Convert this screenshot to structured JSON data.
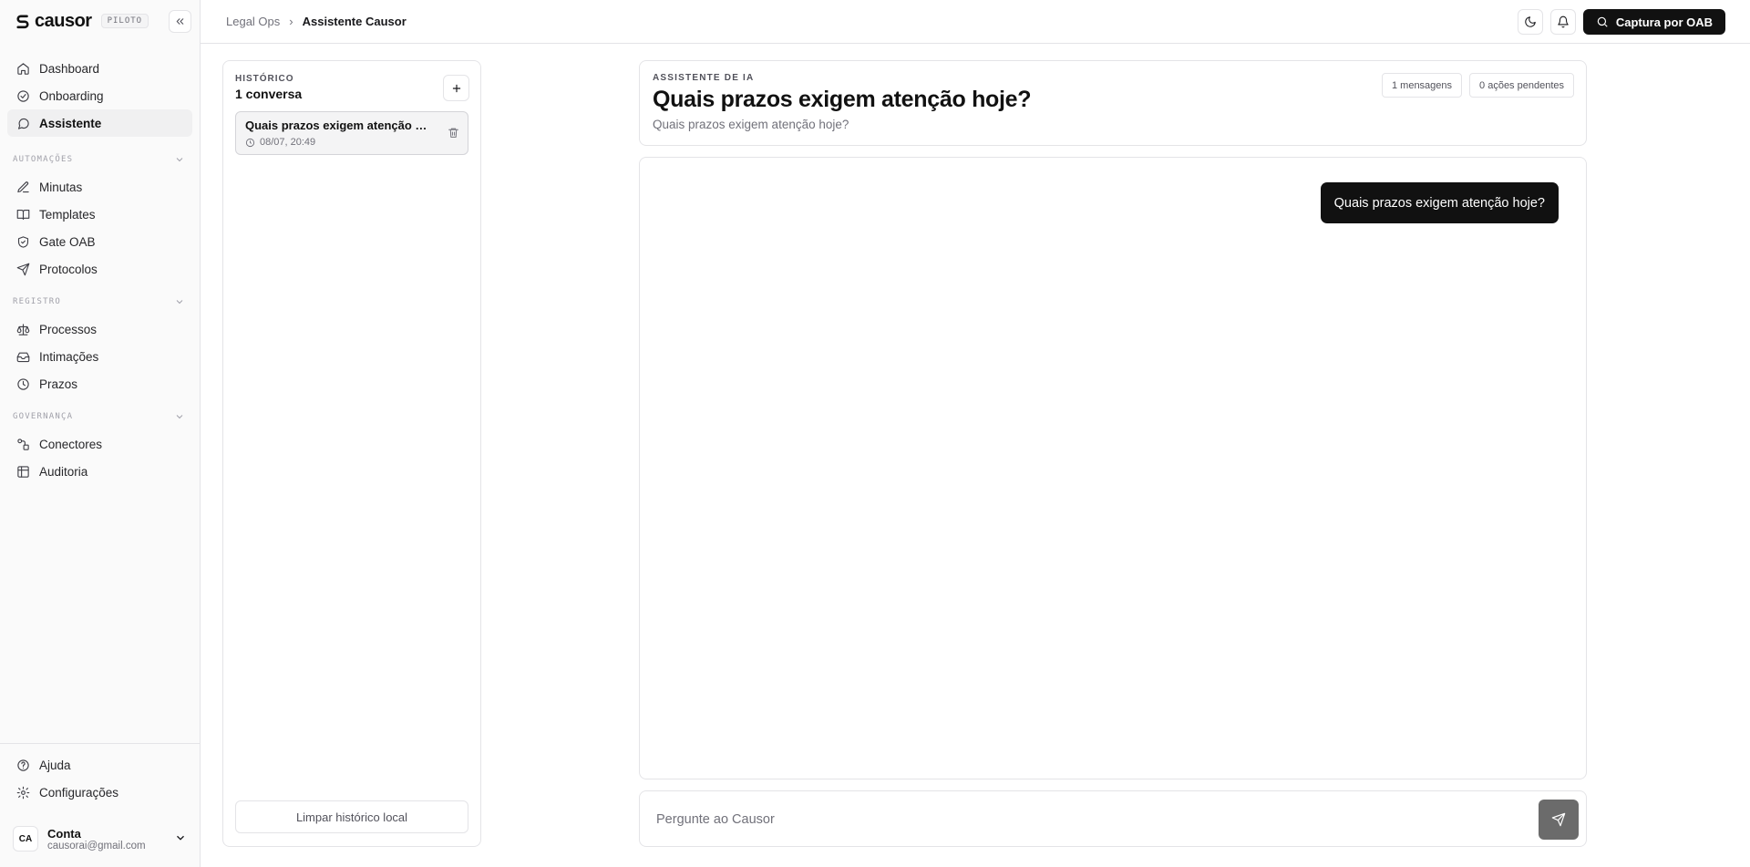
{
  "brand": {
    "name": "causor",
    "badge": "PILOTO"
  },
  "sidebar": {
    "main_items": [
      {
        "label": "Dashboard",
        "icon": "home-icon"
      },
      {
        "label": "Onboarding",
        "icon": "check-circle-icon"
      },
      {
        "label": "Assistente",
        "icon": "chat-bubble-icon",
        "active": true
      }
    ],
    "sections": [
      {
        "title": "AUTOMAÇÕES",
        "items": [
          {
            "label": "Minutas",
            "icon": "edit-icon"
          },
          {
            "label": "Templates",
            "icon": "book-icon"
          },
          {
            "label": "Gate OAB",
            "icon": "shield-check-icon"
          },
          {
            "label": "Protocolos",
            "icon": "send-icon"
          }
        ]
      },
      {
        "title": "REGISTRO",
        "items": [
          {
            "label": "Processos",
            "icon": "scale-icon"
          },
          {
            "label": "Intimações",
            "icon": "inbox-icon"
          },
          {
            "label": "Prazos",
            "icon": "clock-icon"
          }
        ]
      },
      {
        "title": "GOVERNANÇA",
        "items": [
          {
            "label": "Conectores",
            "icon": "connector-icon"
          },
          {
            "label": "Auditoria",
            "icon": "table-icon"
          }
        ]
      }
    ],
    "bottom_items": [
      {
        "label": "Ajuda",
        "icon": "help-circle-icon"
      },
      {
        "label": "Configurações",
        "icon": "gear-icon"
      }
    ],
    "account": {
      "initials": "CA",
      "name": "Conta",
      "email": "causorai@gmail.com"
    }
  },
  "topbar": {
    "breadcrumb_parent": "Legal Ops",
    "breadcrumb_current": "Assistente Causor",
    "cta_label": "Captura por OAB"
  },
  "history": {
    "label": "HISTÓRICO",
    "count": "1 conversa",
    "conversations": [
      {
        "title": "Quais prazos exigem atenção hoje?",
        "timestamp": "08/07, 20:49"
      }
    ],
    "clear_label": "Limpar histórico local"
  },
  "assistant": {
    "eyebrow": "ASSISTENTE DE IA",
    "title": "Quais prazos exigem atenção hoje?",
    "subtitle": "Quais prazos exigem atenção hoje?",
    "chips": [
      "1 mensagens",
      "0 ações pendentes"
    ]
  },
  "chat": {
    "messages": [
      {
        "role": "user",
        "text": "Quais prazos exigem atenção hoje?"
      }
    ]
  },
  "composer": {
    "placeholder": "Pergunte ao Causor"
  },
  "colors": {
    "accent": "#111111",
    "border": "#e4e4e7",
    "muted": "#71717a",
    "send_button": "#6b6b6b"
  }
}
